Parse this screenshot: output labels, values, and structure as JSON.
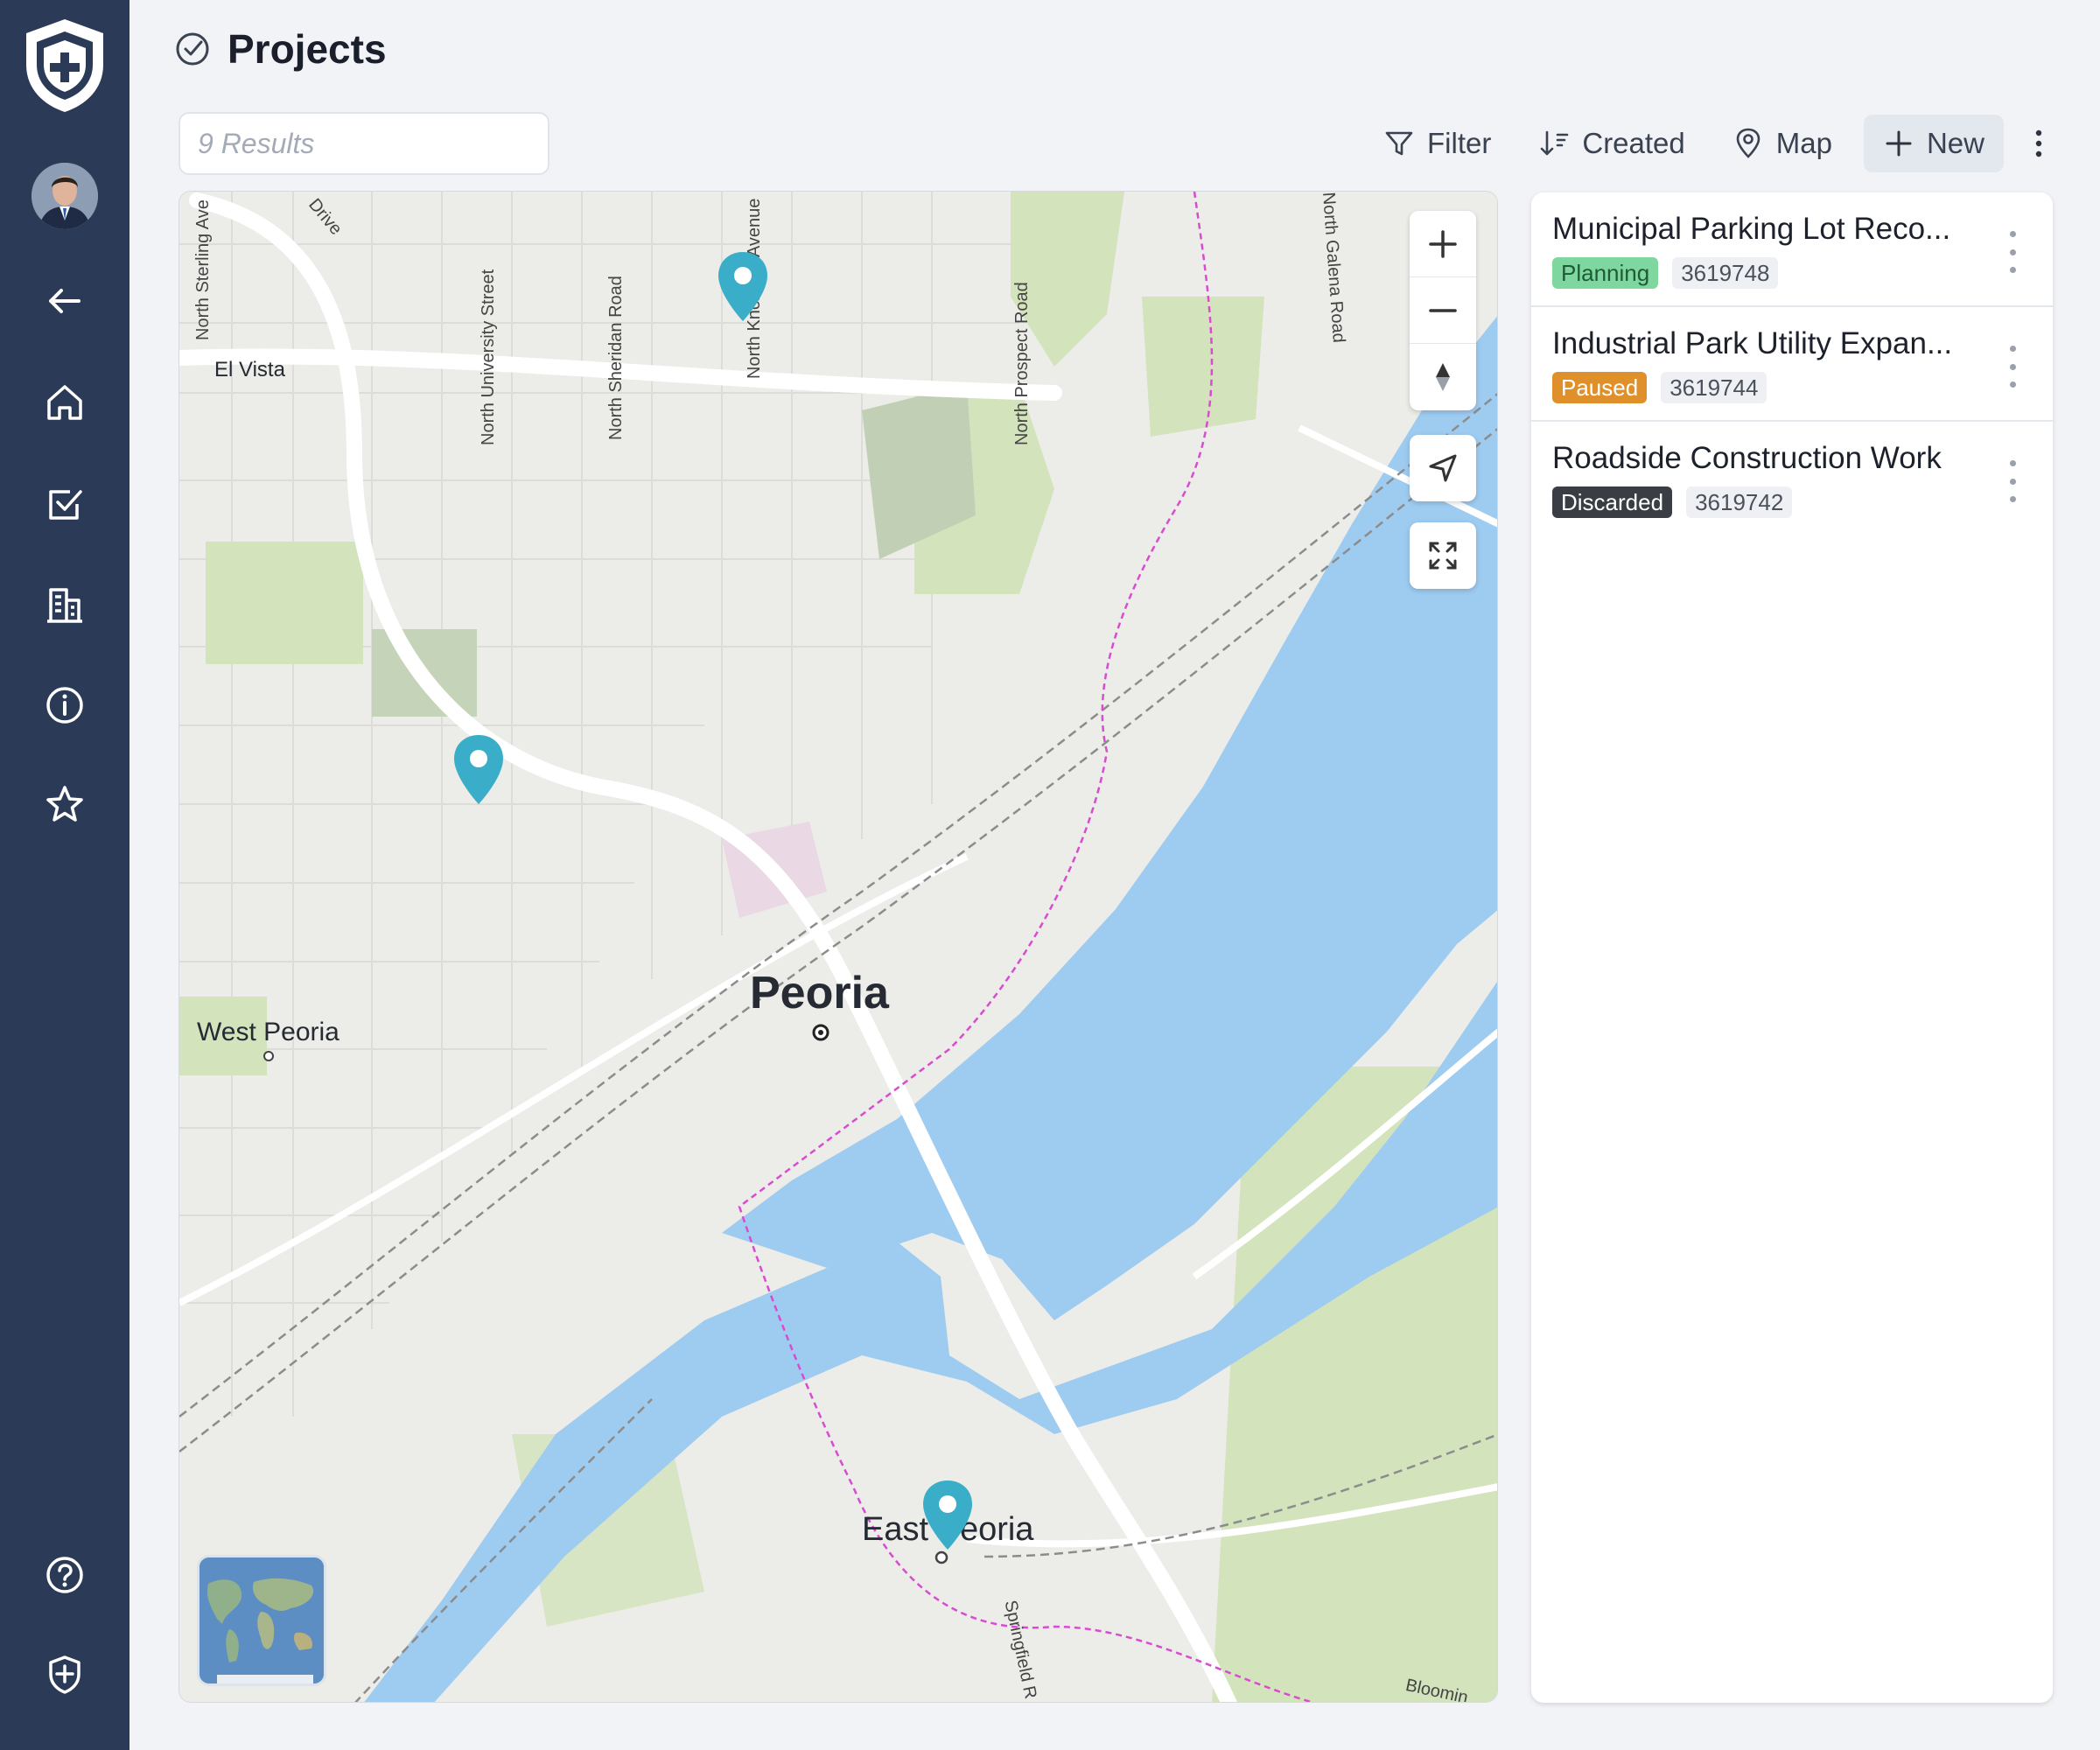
{
  "page": {
    "title": "Projects"
  },
  "search": {
    "placeholder": "9 Results"
  },
  "toolbar": {
    "filter_label": "Filter",
    "sort_label": "Created",
    "view_label": "Map",
    "new_label": "New"
  },
  "sidebar": {
    "items": [
      {
        "icon": "back-arrow-icon"
      },
      {
        "icon": "home-icon"
      },
      {
        "icon": "checkbox-icon"
      },
      {
        "icon": "building-icon"
      },
      {
        "icon": "info-icon"
      },
      {
        "icon": "star-icon"
      },
      {
        "icon": "help-icon"
      },
      {
        "icon": "shield-icon"
      }
    ]
  },
  "map": {
    "city_labels": {
      "peoria": "Peoria",
      "west_peoria": "West Peoria",
      "east_peoria": "East Peoria",
      "el_vista": "El Vista"
    },
    "road_labels": {
      "sterling": "North Sterling Ave",
      "drive": "Drive",
      "university": "North University Street",
      "sheridan": "North Sheridan Road",
      "knoxville": "North Knoxville Avenue",
      "prospect": "North Prospect Road",
      "galena": "North Galena Road",
      "springfield": "Springfield R",
      "bloomington": "Bloomin"
    },
    "colors": {
      "water": "#9ecbf0",
      "park": "#cfe2b8",
      "pin": "#3aaec8"
    }
  },
  "projects": [
    {
      "title": "Municipal Parking Lot Reco...",
      "status": "Planning",
      "status_color": "#7fd7a0",
      "id": "3619748"
    },
    {
      "title": "Industrial Park Utility Expan...",
      "status": "Paused",
      "status_color": "#e0902a",
      "id": "3619744"
    },
    {
      "title": "Roadside Construction Work",
      "status": "Discarded",
      "status_color": "#3a3d44",
      "id": "3619742"
    }
  ]
}
